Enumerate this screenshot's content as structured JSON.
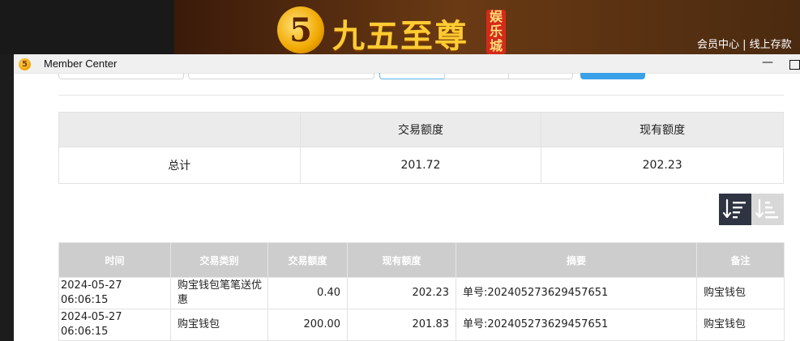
{
  "site": {
    "logo_mark": "5",
    "logo_text": "九五至尊",
    "logo_badge": "娱乐城",
    "links": "会员中心 | 线上存款"
  },
  "window": {
    "title": "Member Center",
    "minimize": "—",
    "icon": "app-logo-icon"
  },
  "summary": {
    "headers": [
      "",
      "交易额度",
      "现有额度"
    ],
    "row": {
      "label": "总计",
      "transaction_amount": "201.72",
      "current_amount": "202.23"
    }
  },
  "detail": {
    "headers": [
      "时间",
      "交易类别",
      "交易额度",
      "现有额度",
      "摘要",
      "备注"
    ],
    "rows": [
      {
        "time": "2024-05-27 06:06:15",
        "type": "购宝钱包笔笔送优惠",
        "amount": "0.40",
        "balance": "202.23",
        "summary": "单号:202405273629457651",
        "note": "购宝钱包"
      },
      {
        "time": "2024-05-27 06:06:15",
        "type": "购宝钱包",
        "amount": "200.00",
        "balance": "201.83",
        "summary": "单号:202405273629457651",
        "note": "购宝钱包"
      }
    ]
  },
  "colors": {
    "sort_active": "#2e3442",
    "sort_inactive": "#d8d8d8",
    "header_gray": "#cdcdcd",
    "accent_blue": "#3aa0e8"
  }
}
